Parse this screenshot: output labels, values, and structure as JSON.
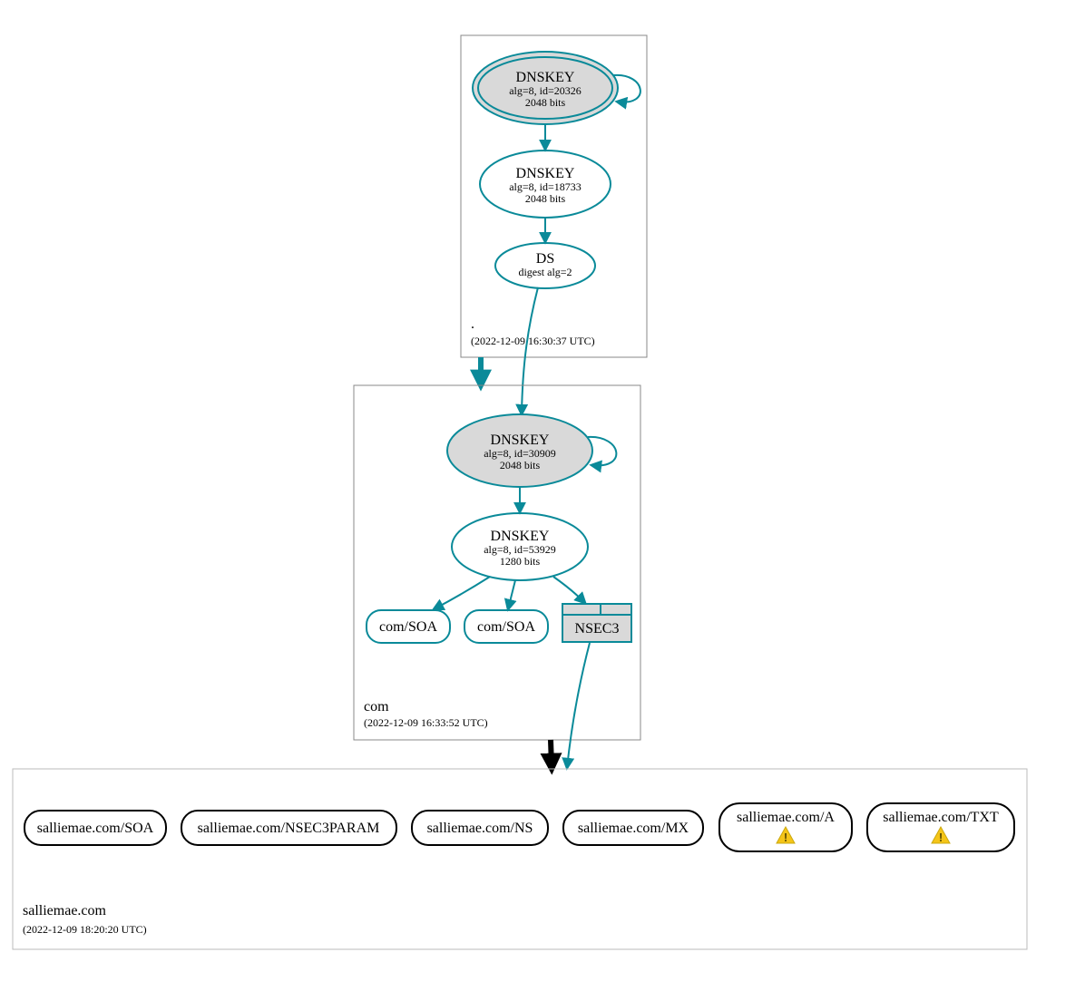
{
  "zones": {
    "root": {
      "label": ".",
      "timestamp": "(2022-12-09 16:30:37 UTC)",
      "nodes": {
        "ksk": {
          "title": "DNSKEY",
          "line2": "alg=8, id=20326",
          "line3": "2048 bits"
        },
        "zsk": {
          "title": "DNSKEY",
          "line2": "alg=8, id=18733",
          "line3": "2048 bits"
        },
        "ds": {
          "title": "DS",
          "line2": "digest alg=2"
        }
      }
    },
    "com": {
      "label": "com",
      "timestamp": "(2022-12-09 16:33:52 UTC)",
      "nodes": {
        "ksk": {
          "title": "DNSKEY",
          "line2": "alg=8, id=30909",
          "line3": "2048 bits"
        },
        "zsk": {
          "title": "DNSKEY",
          "line2": "alg=8, id=53929",
          "line3": "1280 bits"
        },
        "soa1": {
          "title": "com/SOA"
        },
        "soa2": {
          "title": "com/SOA"
        },
        "nsec3": {
          "title": "NSEC3"
        }
      }
    },
    "salliemae": {
      "label": "salliemae.com",
      "timestamp": "(2022-12-09 18:20:20 UTC)",
      "nodes": {
        "soa": {
          "title": "salliemae.com/SOA"
        },
        "nsec3param": {
          "title": "salliemae.com/NSEC3PARAM"
        },
        "ns": {
          "title": "salliemae.com/NS"
        },
        "mx": {
          "title": "salliemae.com/MX"
        },
        "a": {
          "title": "salliemae.com/A"
        },
        "txt": {
          "title": "salliemae.com/TXT"
        }
      }
    }
  }
}
